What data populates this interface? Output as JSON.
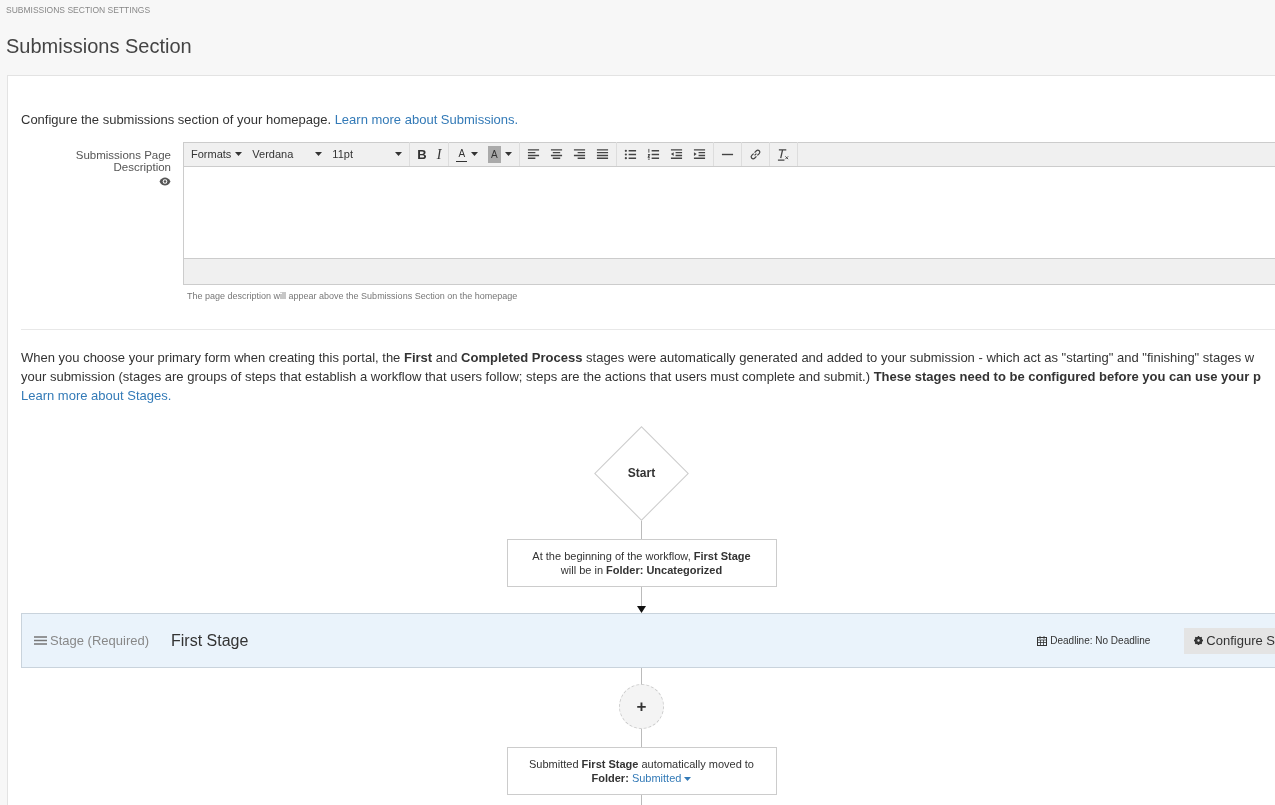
{
  "breadcrumb": "SUBMISSIONS SECTION SETTINGS",
  "title": "Submissions Section",
  "intro": {
    "text": "Configure the submissions section of your homepage. ",
    "link": "Learn more about Submissions."
  },
  "description_field": {
    "label": "Submissions Page Description",
    "hint": "The page description will appear above the Submissions Section on the homepage"
  },
  "editor_toolbar": [
    [
      {
        "kind": "menu",
        "label": "Formats"
      },
      {
        "kind": "select",
        "label": "Verdana"
      },
      {
        "kind": "select",
        "label": "11pt"
      }
    ],
    [
      {
        "kind": "bold",
        "label": "B"
      },
      {
        "kind": "italic",
        "label": "I"
      }
    ],
    [
      {
        "kind": "text-color",
        "label": "A"
      },
      {
        "kind": "highlight-color",
        "label": "A"
      }
    ],
    [
      {
        "kind": "align-left"
      },
      {
        "kind": "align-center"
      },
      {
        "kind": "align-right"
      },
      {
        "kind": "justify"
      }
    ],
    [
      {
        "kind": "bullet-list"
      },
      {
        "kind": "number-list"
      },
      {
        "kind": "outdent"
      },
      {
        "kind": "indent"
      }
    ],
    [
      {
        "kind": "horizontal-rule"
      }
    ],
    [
      {
        "kind": "link"
      }
    ],
    [
      {
        "kind": "clear-format"
      }
    ]
  ],
  "stages_info": {
    "lines": [
      "When you choose your primary form when creating this portal, the **First** and **Completed Process** stages were automatically generated and added to your submission - which act as \"starting\" and \"finishing\" stages w",
      "your submission (stages are groups of steps that establish a workflow that users follow; steps are the actions that users must complete and submit.) **These stages need to be configured before you can use your p**"
    ],
    "link": "Learn more about Stages."
  },
  "workflow": {
    "start": "Start",
    "start_note": "At the beginning of the workflow, **First Stage** will be in **Folder: Uncategorized**",
    "stage": {
      "type": "Stage (Required)",
      "name": "First Stage",
      "deadline": "Deadline: No Deadline",
      "button": "Configure S"
    },
    "add_button": "+",
    "end_note": {
      "text": "Submitted **First Stage** automatically moved to **Folder:** ",
      "folder": "Submitted"
    }
  }
}
